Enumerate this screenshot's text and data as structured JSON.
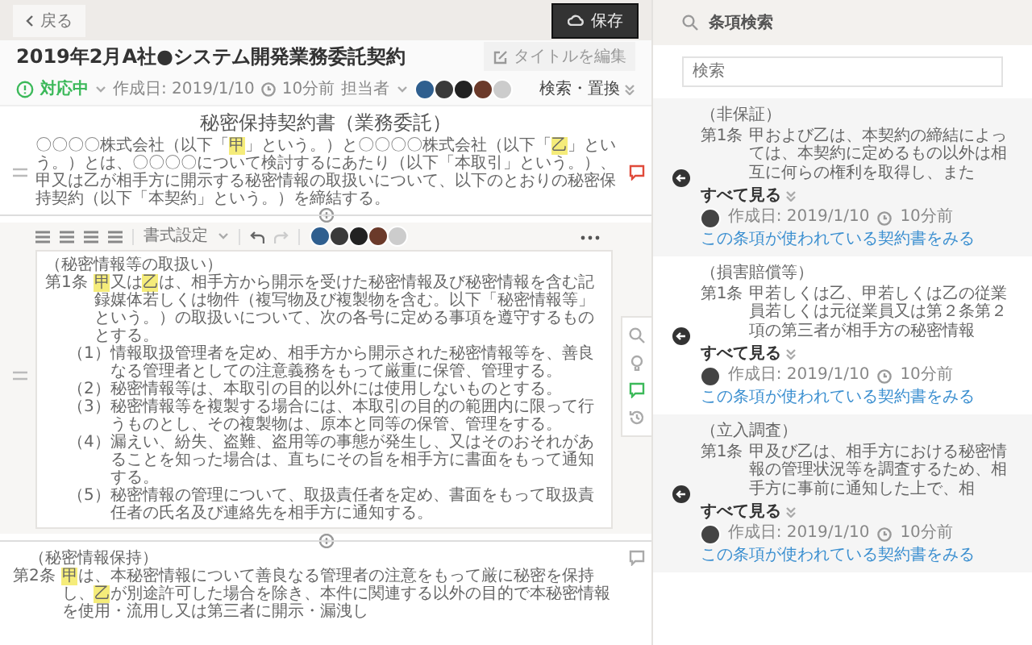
{
  "top_bar": {
    "back": "戻る",
    "save": "保存"
  },
  "contract": {
    "title": "2019年2月A社●システム開発業務委託契約",
    "edit_title": "タイトルを編集",
    "status": "対応中",
    "created": "作成日: 2019/1/10",
    "updated": "10分前",
    "assignee": "担当者",
    "avatars": [
      {
        "kind": "photo"
      },
      {
        "kind": "photo"
      },
      {
        "kind": "photo"
      },
      {
        "kind": "photo"
      },
      {
        "kind": "more"
      }
    ],
    "search_replace": "検索・置換"
  },
  "document": {
    "title": "秘密保持契約書（業務委託）",
    "preamble": [
      {
        "text": "〇〇〇〇株式会社（以下「",
        "highlight": false
      },
      {
        "text": "甲",
        "highlight": true
      },
      {
        "text": "」という。）と〇〇〇〇株式会社（以下「",
        "highlight": false
      },
      {
        "text": "乙",
        "highlight": true
      },
      {
        "text": "」という。）とは、〇〇〇〇について検討するにあたり（以下「本取引」という。）、甲又は乙が相手方に開示する秘密情報の取扱いについて、以下のとおりの秘密保持契約（以下「本契約」という。）を締結する。",
        "highlight": false
      }
    ],
    "editor": {
      "format": "書式設定",
      "avatars": [
        {
          "kind": "photo"
        },
        {
          "kind": "photo"
        },
        {
          "kind": "photo"
        },
        {
          "kind": "photo"
        },
        {
          "kind": "more"
        }
      ],
      "heading": "（秘密情報等の取扱い）",
      "label": "第1条",
      "body": [
        {
          "text": "甲",
          "highlight": true
        },
        {
          "text": "又は",
          "highlight": false
        },
        {
          "text": "乙",
          "highlight": true
        },
        {
          "text": "は、相手方から開示を受けた秘密情報及び秘密情報を含む記録媒体若しくは物件（複写物及び複製物を含む。以下「秘密情報等」という。）の取扱いについて、次の各号に定める事項を遵守するものとする。",
          "highlight": false
        }
      ],
      "items": [
        {
          "number": "（1）",
          "text": "情報取扱管理者を定め、相手方から開示された秘密情報等を、善良なる管理者としての注意義務をもって厳重に保管、管理する。"
        },
        {
          "number": "（2）",
          "text": "秘密情報等は、本取引の目的以外には使用しないものとする。"
        },
        {
          "number": "（3）",
          "text": "秘密情報等を複製する場合には、本取引の目的の範囲内に限って行うものとし、その複製物は、原本と同等の保管、管理をする。"
        },
        {
          "number": "（4）",
          "text": "漏えい、紛失、盗難、盗用等の事態が発生し、又はそのおそれがあることを知った場合は、直ちにその旨を相手方に書面をもって通知する。"
        },
        {
          "number": "（5）",
          "text": "秘密情報の管理について、取扱責任者を定め、書面をもって取扱責任者の氏名及び連絡先を相手方に通知する。"
        }
      ]
    },
    "next_clause": {
      "heading": "（秘密情報保持）",
      "label": "第2条",
      "body": [
        {
          "text": "甲",
          "highlight": true
        },
        {
          "text": "は、本秘密情報について善良なる管理者の注意をもって厳に秘密を保持し、",
          "highlight": false
        },
        {
          "text": "乙",
          "highlight": true
        },
        {
          "text": "が別途許可した場合を除き、本件に関連する以外の目的で本秘密情報を使用・流用し又は第三者に開示・漏洩し",
          "highlight": false
        }
      ]
    }
  },
  "clause_search": {
    "title": "条項検索",
    "placeholder": "検索",
    "results": [
      {
        "heading": "（非保証）",
        "label": "第1条",
        "text": "甲および乙は、本契約の締結によっては、本契約に定めるもの以外は相互に何らの権利を取得し、また",
        "see_all": "すべて見る",
        "created": "作成日: 2019/1/10",
        "updated": "10分前",
        "link": "この条項が使われている契約書をみる"
      },
      {
        "heading": "（損害賠償等）",
        "label": "第1条",
        "text": "甲若しくは乙、甲若しくは乙の従業員若しくは元従業員又は第２条第２項の第三者が相手方の秘密情報",
        "see_all": "すべて見る",
        "created": "作成日: 2019/1/10",
        "updated": "10分前",
        "link": "この条項が使われている契約書をみる"
      },
      {
        "heading": "（立入調査）",
        "label": "第1条",
        "text": "甲及び乙は、相手方における秘密情報の管理状況等を調査するため、相手方に事前に通知した上で、相",
        "see_all": "すべて見る",
        "created": "作成日: 2019/1/10",
        "updated": "10分前",
        "link": "この条項が使われている契約書をみる"
      }
    ]
  }
}
